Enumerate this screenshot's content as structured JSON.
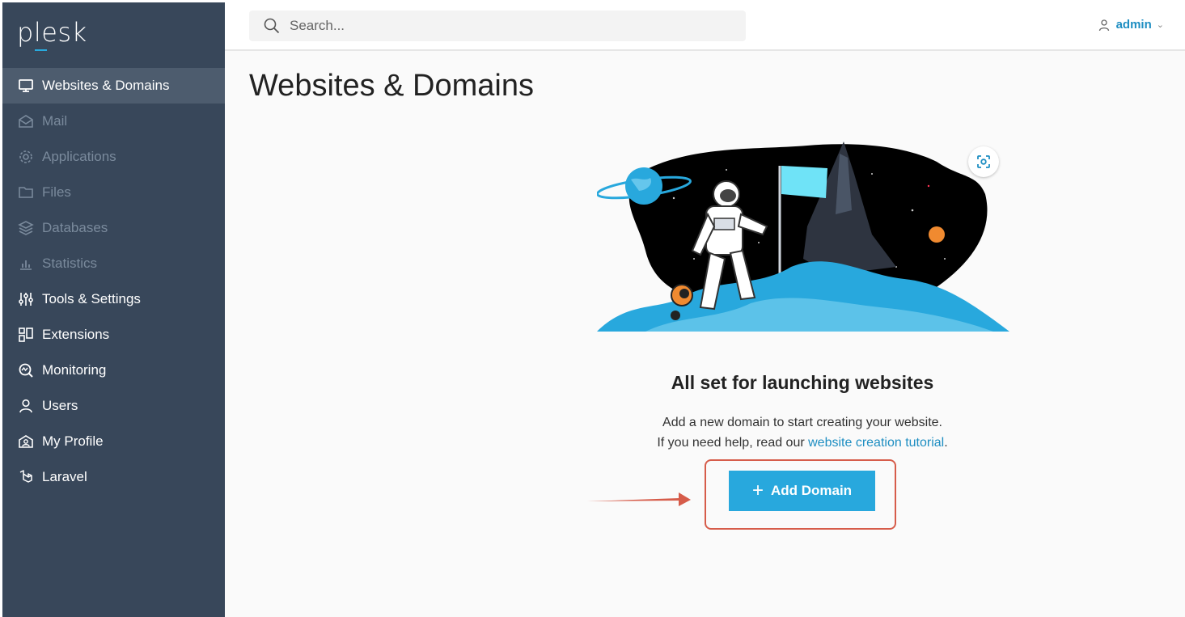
{
  "app": {
    "logo": "plesk"
  },
  "sidebar": {
    "items": [
      {
        "label": "Websites & Domains",
        "icon": "monitor-icon",
        "state": "active"
      },
      {
        "label": "Mail",
        "icon": "mail-icon",
        "state": "dim"
      },
      {
        "label": "Applications",
        "icon": "gear-icon",
        "state": "dim"
      },
      {
        "label": "Files",
        "icon": "folder-icon",
        "state": "dim"
      },
      {
        "label": "Databases",
        "icon": "database-icon",
        "state": "dim"
      },
      {
        "label": "Statistics",
        "icon": "bar-chart-icon",
        "state": "dim"
      },
      {
        "label": "Tools & Settings",
        "icon": "sliders-icon",
        "state": "normal"
      },
      {
        "label": "Extensions",
        "icon": "extensions-icon",
        "state": "normal"
      },
      {
        "label": "Monitoring",
        "icon": "monitoring-icon",
        "state": "normal"
      },
      {
        "label": "Users",
        "icon": "user-icon",
        "state": "normal"
      },
      {
        "label": "My Profile",
        "icon": "profile-icon",
        "state": "normal"
      },
      {
        "label": "Laravel",
        "icon": "laravel-icon",
        "state": "normal"
      }
    ],
    "collapse_glyph": "‹"
  },
  "topbar": {
    "search_placeholder": "Search...",
    "user_name": "admin",
    "user_caret": "⌄"
  },
  "main": {
    "title": "Websites & Domains",
    "hero_title": "All set for launching websites",
    "hero_line1": "Add a new domain to start creating your website.",
    "hero_line2_prefix": "If you need help, read our ",
    "hero_link": "website creation tutorial",
    "hero_line2_suffix": ".",
    "add_button_plus": "+",
    "add_button_label": "Add Domain"
  },
  "colors": {
    "sidebar_bg": "#38475a",
    "sidebar_active": "#4d5c6e",
    "accent": "#28a8dd",
    "link": "#1e8ec2",
    "annotation": "#d65c4a"
  }
}
